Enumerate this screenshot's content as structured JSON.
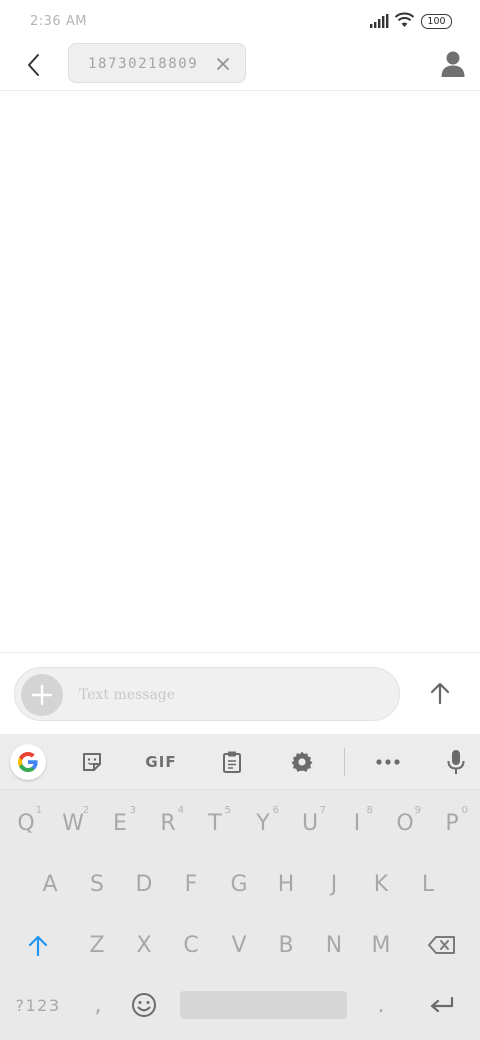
{
  "status_bar": {
    "time": "2:36 AM",
    "battery": "100",
    "icons": [
      "signal-icon",
      "wifi-icon",
      "battery-icon"
    ]
  },
  "header": {
    "recipient": "18730218809",
    "icons": [
      "back-arrow-icon",
      "close-icon",
      "contact-icon"
    ]
  },
  "compose": {
    "placeholder": "Text message",
    "icons": [
      "plus-icon",
      "send-arrow-icon"
    ]
  },
  "keyboard": {
    "toolbar": {
      "gif_label": "GIF",
      "icons": [
        "google-g-icon",
        "sticker-icon",
        "clipboard-icon",
        "gear-icon",
        "more-dots-icon",
        "microphone-icon"
      ]
    },
    "row1": [
      {
        "key": "Q",
        "hint": "1"
      },
      {
        "key": "W",
        "hint": "2"
      },
      {
        "key": "E",
        "hint": "3"
      },
      {
        "key": "R",
        "hint": "4"
      },
      {
        "key": "T",
        "hint": "5"
      },
      {
        "key": "Y",
        "hint": "6"
      },
      {
        "key": "U",
        "hint": "7"
      },
      {
        "key": "I",
        "hint": "8"
      },
      {
        "key": "O",
        "hint": "9"
      },
      {
        "key": "P",
        "hint": "0"
      }
    ],
    "row2": [
      "A",
      "S",
      "D",
      "F",
      "G",
      "H",
      "J",
      "K",
      "L"
    ],
    "row3": [
      "Z",
      "X",
      "C",
      "V",
      "B",
      "N",
      "M"
    ],
    "row4": {
      "symbols": "?123",
      "comma": ",",
      "period": "."
    },
    "accent_color": "#2196f3"
  }
}
